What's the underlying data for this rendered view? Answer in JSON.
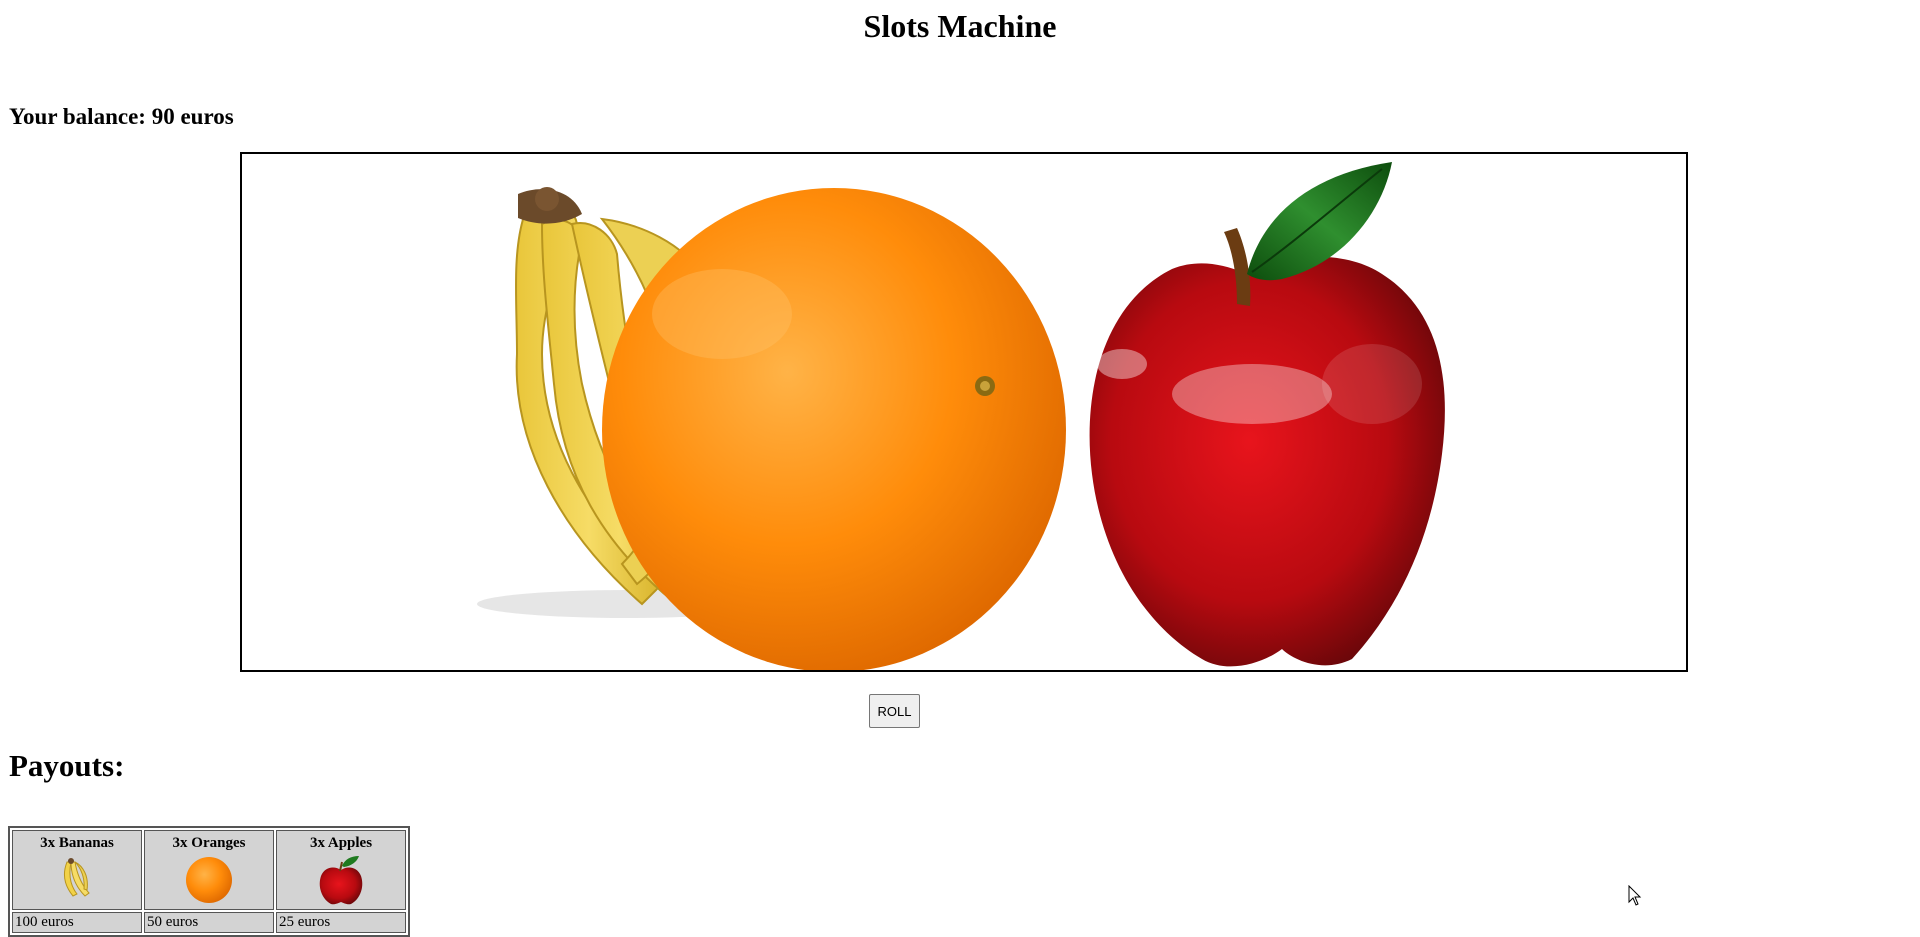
{
  "header": {
    "title": "Slots Machine"
  },
  "balance": {
    "text": "Your balance: 90 euros"
  },
  "reels": {
    "symbols": [
      "banana-bunch",
      "orange",
      "red-apple"
    ]
  },
  "controls": {
    "roll_label": "ROLL"
  },
  "payouts": {
    "heading": "Payouts:",
    "combos": [
      {
        "label": "3x Bananas",
        "icon": "banana-icon",
        "reward": "100 euros"
      },
      {
        "label": "3x Oranges",
        "icon": "orange-icon",
        "reward": "50 euros"
      },
      {
        "label": "3x Apples",
        "icon": "apple-icon",
        "reward": "25 euros"
      }
    ]
  },
  "colors": {
    "banana": "#f2d248",
    "orange": "#ff8c0a",
    "apple": "#b80a10",
    "leaf": "#1f7a1f",
    "table_cell": "#d3d3d3"
  }
}
